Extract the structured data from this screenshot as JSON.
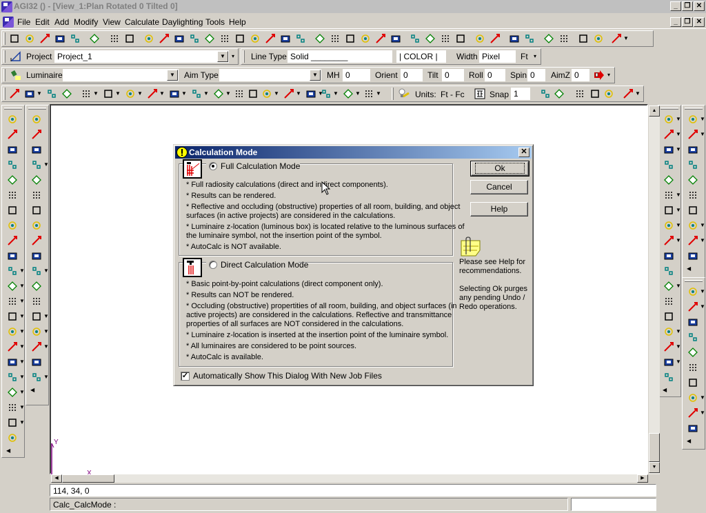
{
  "window": {
    "title": "AGI32 () - [View_1:Plan Rotated 0 Tilted 0]",
    "controls": {
      "minimize": "_",
      "restore": "❐",
      "close": "✕"
    }
  },
  "menubar": {
    "items": [
      {
        "label": "File",
        "key": "F"
      },
      {
        "label": "Edit",
        "key": "E"
      },
      {
        "label": "Add",
        "key": "A"
      },
      {
        "label": "Modify",
        "key": "M"
      },
      {
        "label": "View",
        "key": "V"
      },
      {
        "label": "Calculate",
        "key": "C"
      },
      {
        "label": "Daylighting",
        "key": "D"
      },
      {
        "label": "Tools",
        "key": "T"
      },
      {
        "label": "Help",
        "key": "H"
      }
    ]
  },
  "toolbar_main": {
    "icons": [
      "new-file-icon",
      "open-folder-icon",
      "import-icon",
      "export-icon",
      "save-icon",
      "print-icon",
      "undo-icon",
      "redo-icon",
      "pencil-icon",
      "pan-hand-icon",
      "pan-hand-2-icon",
      "zoom-point-icon",
      "zoom-in-icon",
      "zoom-out-icon",
      "zoom-window-icon",
      "zoom-extents-icon",
      "zoom-last-icon",
      "view-back-icon",
      "render-view-icon",
      "view-icon",
      "axis-arrow-icon",
      "box-arrow-icon",
      "arrow-left-icon",
      "arrow-in-icon",
      "eye-folder-icon",
      "view-iso-1-icon",
      "view-iso-2-icon",
      "view-iso-3-icon",
      "view-iso-4-icon",
      "eye-icon",
      "percent-icon",
      "calc-panel-icon",
      "render-icon",
      "bars-icon",
      "grid-icon",
      "ruler-icon",
      "ruler-2-icon",
      "query-icon"
    ]
  },
  "toolbar_project": {
    "project_label": "Project",
    "project_value": "Project_1",
    "line_type_label": "Line Type",
    "line_type_value": "Solid ________",
    "color_value": "| COLOR |",
    "width_label": "Width",
    "width_value": "Pixel",
    "units_value": "Ft"
  },
  "toolbar_luminaire": {
    "luminaire_label": "Luminaire",
    "luminaire_value": "",
    "aim_type_label": "Aim Type",
    "aim_type_value": "",
    "mh_label": "MH",
    "mh_value": "0",
    "orient_label": "Orient",
    "orient_value": "0",
    "tilt_label": "Tilt",
    "tilt_value": "0",
    "roll_label": "Roll",
    "roll_value": "0",
    "spin_label": "Spin",
    "spin_value": "0",
    "aimz_label": "AimZ",
    "aimz_value": "0"
  },
  "toolbar_calc": {
    "units_label": "Units:",
    "units_value": "Ft  - Fc",
    "snap_label": "Snap",
    "snap_value": "1"
  },
  "dialog": {
    "title": "Calculation Mode",
    "full_mode": {
      "label": "Full Calculation Mode",
      "selected": true,
      "lines": [
        "* Full radiosity calculations (direct and indirect components).",
        "* Results can be rendered.",
        "* Reflective and occluding (obstructive) properties of all room, building, and object",
        "surfaces (in active projects) are considered in the calculations.",
        "* Luminaire z-location (luminous box) is located relative to the luminous surfaces of",
        "the luminaire symbol, not the insertion point of the symbol.",
        "* AutoCalc is NOT available."
      ]
    },
    "direct_mode": {
      "label": "Direct Calculation Mode",
      "selected": false,
      "lines": [
        "* Basic point-by-point calculations (direct component only).",
        "* Results can NOT be rendered.",
        "* Occluding (obstructive) propertities of all room, building, and object surfaces (in",
        "active projects) are considered in the calculations. Reflective and transmittance",
        "properties of all surfaces are NOT considered in the calculations.",
        "* Luminaire z-location is inserted at the insertion point of the luminaire symbol.",
        "* All luminaires are considered to be point sources.",
        "* AutoCalc is available."
      ]
    },
    "buttons": {
      "ok": "Ok",
      "cancel": "Cancel",
      "help": "Help"
    },
    "note_1": [
      "Please see Help for",
      "recommendations."
    ],
    "note_2": [
      "Selecting Ok purges",
      "any pending Undo /",
      "Redo operations."
    ],
    "auto_show_label": "Automatically Show This Dialog With New Job Files",
    "auto_show_checked": true
  },
  "canvas": {
    "axis_y_label": "Y",
    "axis_x_label": "X"
  },
  "status": {
    "coordinates": "114,  34,  0",
    "command": "Calc_CalcMode :",
    "aux": ""
  }
}
